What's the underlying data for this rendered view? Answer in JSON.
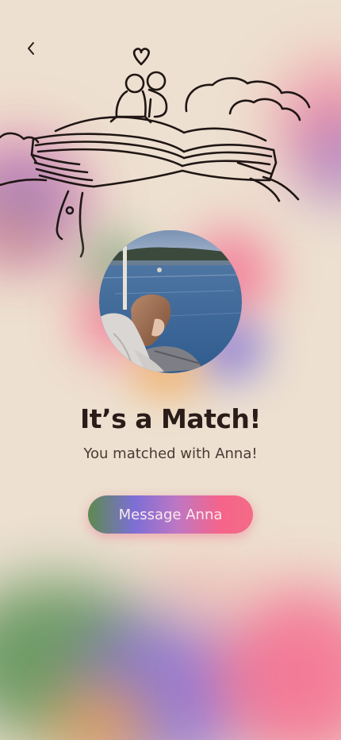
{
  "header": {
    "back_icon": "chevron-left-icon"
  },
  "illustration": {
    "icon": "couple-on-book-illustration"
  },
  "match": {
    "photo_icon": "profile-photo",
    "title": "It’s a Match!",
    "subtitle": "You matched with Anna!"
  },
  "actions": {
    "message_label": "Message Anna"
  },
  "colors": {
    "background": "#ede0d0",
    "text": "#2a1c18",
    "accent_pink": "#f5648a",
    "accent_purple": "#7c6fd6",
    "accent_green": "#5d8a4f",
    "accent_orange": "#f2a24a"
  }
}
